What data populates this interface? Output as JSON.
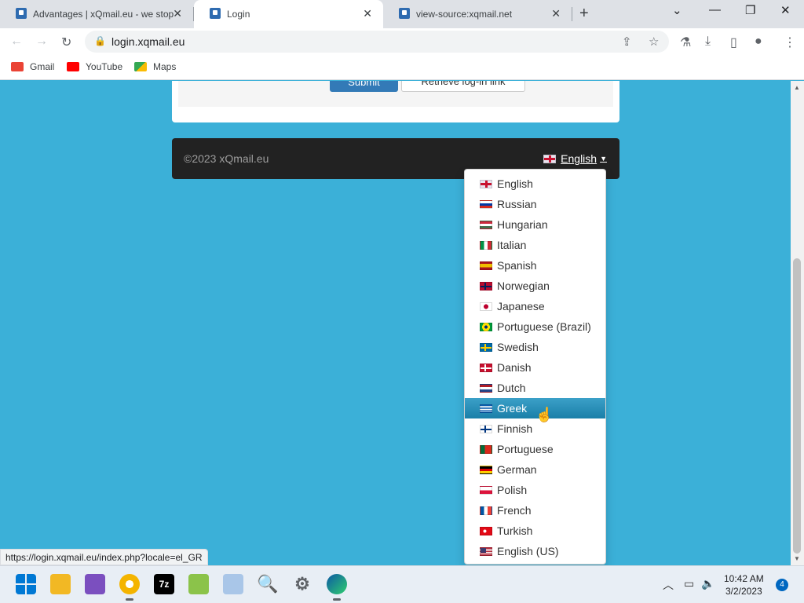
{
  "browser": {
    "tabs": [
      {
        "title": "Advantages | xQmail.eu - we stop",
        "active": false
      },
      {
        "title": "Login",
        "active": true
      },
      {
        "title": "view-source:xqmail.net",
        "active": false
      }
    ],
    "url": "login.xqmail.eu",
    "bookmarks": [
      {
        "label": "Gmail",
        "icon": "gmail-icon"
      },
      {
        "label": "YouTube",
        "icon": "youtube-icon"
      },
      {
        "label": "Maps",
        "icon": "maps-icon"
      }
    ],
    "status_url": "https://login.xqmail.eu/index.php?locale=el_GR"
  },
  "page": {
    "submit_label": "Submit",
    "retrieve_label": "Retrieve log-in link",
    "footer": {
      "copyright": "©2023 xQmail.eu",
      "current_language": "English"
    },
    "languages": [
      {
        "label": "English",
        "flag": "gb",
        "highlighted": false
      },
      {
        "label": "Russian",
        "flag": "ru",
        "highlighted": false
      },
      {
        "label": "Hungarian",
        "flag": "hu",
        "highlighted": false
      },
      {
        "label": "Italian",
        "flag": "it",
        "highlighted": false
      },
      {
        "label": "Spanish",
        "flag": "es",
        "highlighted": false
      },
      {
        "label": "Norwegian",
        "flag": "no",
        "highlighted": false
      },
      {
        "label": "Japanese",
        "flag": "jp",
        "highlighted": false
      },
      {
        "label": "Portuguese (Brazil)",
        "flag": "br",
        "highlighted": false
      },
      {
        "label": "Swedish",
        "flag": "se",
        "highlighted": false
      },
      {
        "label": "Danish",
        "flag": "dk",
        "highlighted": false
      },
      {
        "label": "Dutch",
        "flag": "nl",
        "highlighted": false
      },
      {
        "label": "Greek",
        "flag": "gr",
        "highlighted": true
      },
      {
        "label": "Finnish",
        "flag": "fi",
        "highlighted": false
      },
      {
        "label": "Portuguese",
        "flag": "pt",
        "highlighted": false
      },
      {
        "label": "German",
        "flag": "de",
        "highlighted": false
      },
      {
        "label": "Polish",
        "flag": "pl",
        "highlighted": false
      },
      {
        "label": "French",
        "flag": "fr",
        "highlighted": false
      },
      {
        "label": "Turkish",
        "flag": "tr",
        "highlighted": false
      },
      {
        "label": "English (US)",
        "flag": "us",
        "highlighted": false
      }
    ]
  },
  "taskbar": {
    "time": "10:42 AM",
    "date": "3/2/2023",
    "notification_count": "4"
  },
  "colors": {
    "page_background": "#3bb0d8",
    "footer_background": "#222222",
    "highlight": "#1a7fa8"
  }
}
